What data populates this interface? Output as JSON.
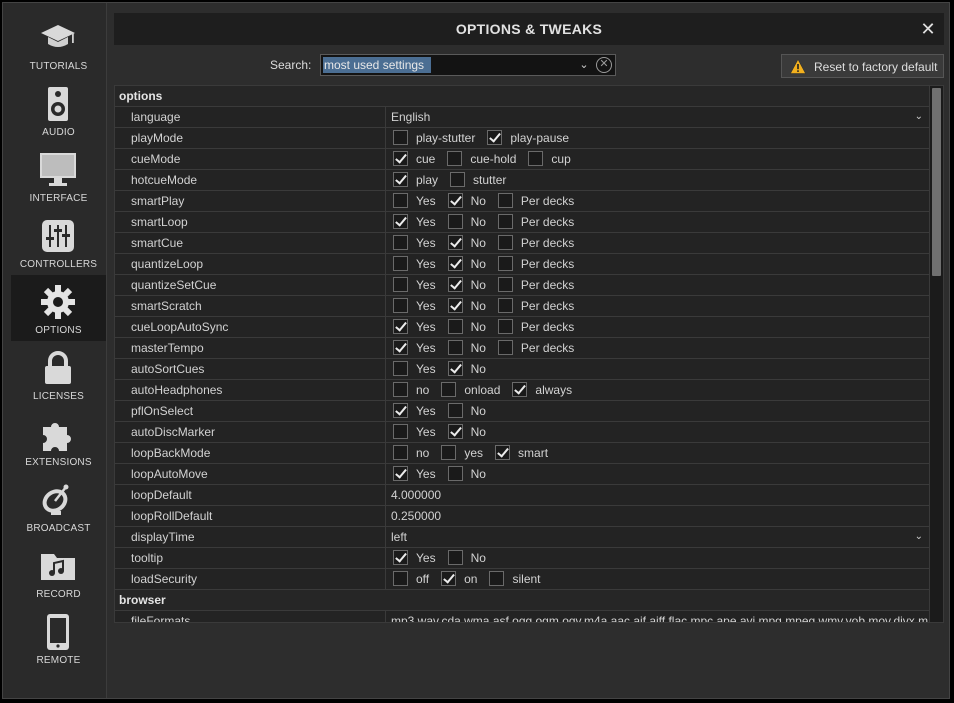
{
  "window": {
    "title": "OPTIONS & TWEAKS"
  },
  "sidebar": {
    "items": [
      {
        "label": "TUTORIALS",
        "icon": "graduation-cap-icon",
        "active": false
      },
      {
        "label": "AUDIO",
        "icon": "speaker-icon",
        "active": false
      },
      {
        "label": "INTERFACE",
        "icon": "monitor-icon",
        "active": false
      },
      {
        "label": "CONTROLLERS",
        "icon": "sliders-icon",
        "active": false
      },
      {
        "label": "OPTIONS",
        "icon": "gear-icon",
        "active": true
      },
      {
        "label": "LICENSES",
        "icon": "lock-icon",
        "active": false
      },
      {
        "label": "EXTENSIONS",
        "icon": "puzzle-icon",
        "active": false
      },
      {
        "label": "BROADCAST",
        "icon": "satellite-dish-icon",
        "active": false
      },
      {
        "label": "RECORD",
        "icon": "music-folder-icon",
        "active": false
      },
      {
        "label": "REMOTE",
        "icon": "phone-icon",
        "active": false
      }
    ]
  },
  "search": {
    "label": "Search:",
    "value": "most used settings"
  },
  "reset": {
    "label": "Reset to factory default"
  },
  "sections": [
    {
      "title": "options",
      "rows": [
        {
          "name": "language",
          "type": "dropdown",
          "value": "English"
        },
        {
          "name": "playMode",
          "type": "checks",
          "options": [
            {
              "label": "play-stutter",
              "checked": false
            },
            {
              "label": "play-pause",
              "checked": true
            }
          ]
        },
        {
          "name": "cueMode",
          "type": "checks",
          "options": [
            {
              "label": "cue",
              "checked": true
            },
            {
              "label": "cue-hold",
              "checked": false
            },
            {
              "label": "cup",
              "checked": false
            }
          ]
        },
        {
          "name": "hotcueMode",
          "type": "checks",
          "options": [
            {
              "label": "play",
              "checked": true
            },
            {
              "label": "stutter",
              "checked": false
            }
          ]
        },
        {
          "name": "smartPlay",
          "type": "checks",
          "options": [
            {
              "label": "Yes",
              "checked": false
            },
            {
              "label": "No",
              "checked": true
            },
            {
              "label": "Per decks",
              "checked": false
            }
          ]
        },
        {
          "name": "smartLoop",
          "type": "checks",
          "options": [
            {
              "label": "Yes",
              "checked": true
            },
            {
              "label": "No",
              "checked": false
            },
            {
              "label": "Per decks",
              "checked": false
            }
          ]
        },
        {
          "name": "smartCue",
          "type": "checks",
          "options": [
            {
              "label": "Yes",
              "checked": false
            },
            {
              "label": "No",
              "checked": true
            },
            {
              "label": "Per decks",
              "checked": false
            }
          ]
        },
        {
          "name": "quantizeLoop",
          "type": "checks",
          "options": [
            {
              "label": "Yes",
              "checked": false
            },
            {
              "label": "No",
              "checked": true
            },
            {
              "label": "Per decks",
              "checked": false
            }
          ]
        },
        {
          "name": "quantizeSetCue",
          "type": "checks",
          "options": [
            {
              "label": "Yes",
              "checked": false
            },
            {
              "label": "No",
              "checked": true
            },
            {
              "label": "Per decks",
              "checked": false
            }
          ]
        },
        {
          "name": "smartScratch",
          "type": "checks",
          "options": [
            {
              "label": "Yes",
              "checked": false
            },
            {
              "label": "No",
              "checked": true
            },
            {
              "label": "Per decks",
              "checked": false
            }
          ]
        },
        {
          "name": "cueLoopAutoSync",
          "type": "checks",
          "options": [
            {
              "label": "Yes",
              "checked": true
            },
            {
              "label": "No",
              "checked": false
            },
            {
              "label": "Per decks",
              "checked": false
            }
          ]
        },
        {
          "name": "masterTempo",
          "type": "checks",
          "options": [
            {
              "label": "Yes",
              "checked": true
            },
            {
              "label": "No",
              "checked": false
            },
            {
              "label": "Per decks",
              "checked": false
            }
          ]
        },
        {
          "name": "autoSortCues",
          "type": "checks",
          "options": [
            {
              "label": "Yes",
              "checked": false
            },
            {
              "label": "No",
              "checked": true
            }
          ]
        },
        {
          "name": "autoHeadphones",
          "type": "checks",
          "options": [
            {
              "label": "no",
              "checked": false
            },
            {
              "label": "onload",
              "checked": false
            },
            {
              "label": "always",
              "checked": true
            }
          ]
        },
        {
          "name": "pflOnSelect",
          "type": "checks",
          "options": [
            {
              "label": "Yes",
              "checked": true
            },
            {
              "label": "No",
              "checked": false
            }
          ]
        },
        {
          "name": "autoDiscMarker",
          "type": "checks",
          "options": [
            {
              "label": "Yes",
              "checked": false
            },
            {
              "label": "No",
              "checked": true
            }
          ]
        },
        {
          "name": "loopBackMode",
          "type": "checks",
          "options": [
            {
              "label": "no",
              "checked": false
            },
            {
              "label": "yes",
              "checked": false
            },
            {
              "label": "smart",
              "checked": true
            }
          ]
        },
        {
          "name": "loopAutoMove",
          "type": "checks",
          "options": [
            {
              "label": "Yes",
              "checked": true
            },
            {
              "label": "No",
              "checked": false
            }
          ]
        },
        {
          "name": "loopDefault",
          "type": "text",
          "value": "4.000000"
        },
        {
          "name": "loopRollDefault",
          "type": "text",
          "value": "0.250000"
        },
        {
          "name": "displayTime",
          "type": "dropdown",
          "value": "left"
        },
        {
          "name": "tooltip",
          "type": "checks",
          "options": [
            {
              "label": "Yes",
              "checked": true
            },
            {
              "label": "No",
              "checked": false
            }
          ]
        },
        {
          "name": "loadSecurity",
          "type": "checks",
          "options": [
            {
              "label": "off",
              "checked": false
            },
            {
              "label": "on",
              "checked": true
            },
            {
              "label": "silent",
              "checked": false
            }
          ]
        }
      ]
    },
    {
      "title": "browser",
      "rows": [
        {
          "name": "fileFormats",
          "type": "text",
          "value": "mp3,wav,cda,wma,asf,ogg,ogm,ogv,m4a,aac,aif,aiff,flac,mpc,ape,avi,mpg,mpeg,wmv,vob,mov,divx,m"
        }
      ]
    }
  ],
  "colors": {
    "accent_selection": "#4b6e93",
    "panel_bg": "#232323",
    "window_bg": "#2d2d2d"
  }
}
